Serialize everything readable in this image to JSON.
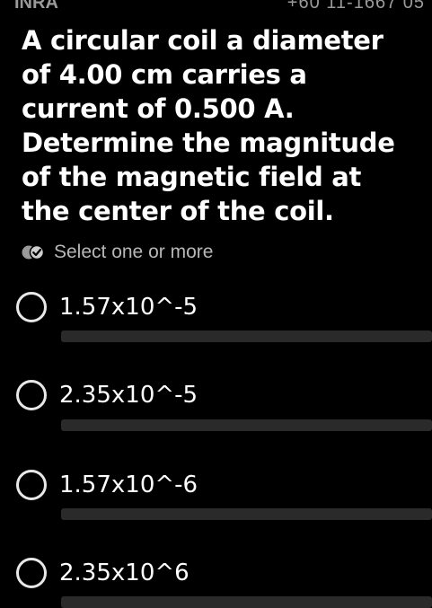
{
  "status": {
    "left_text": "INRA",
    "right_text": "+60 11-1667 05"
  },
  "question": {
    "text": "A circular coil a diameter of 4.00 cm carries a current of 0.500 A. Determine the magnitude of the magnetic field at the center of the coil."
  },
  "hint": {
    "text": "Select one or more",
    "icon": "double-check-icon"
  },
  "options": [
    {
      "label": "1.57x10^-5"
    },
    {
      "label": "2.35x10^-5"
    },
    {
      "label": "1.57x10^-6"
    },
    {
      "label": "2.35x10^6"
    }
  ],
  "colors": {
    "background": "#000000",
    "text": "#ffffff",
    "hint_text": "#b7b7b7",
    "divider": "#2a2a2a"
  }
}
